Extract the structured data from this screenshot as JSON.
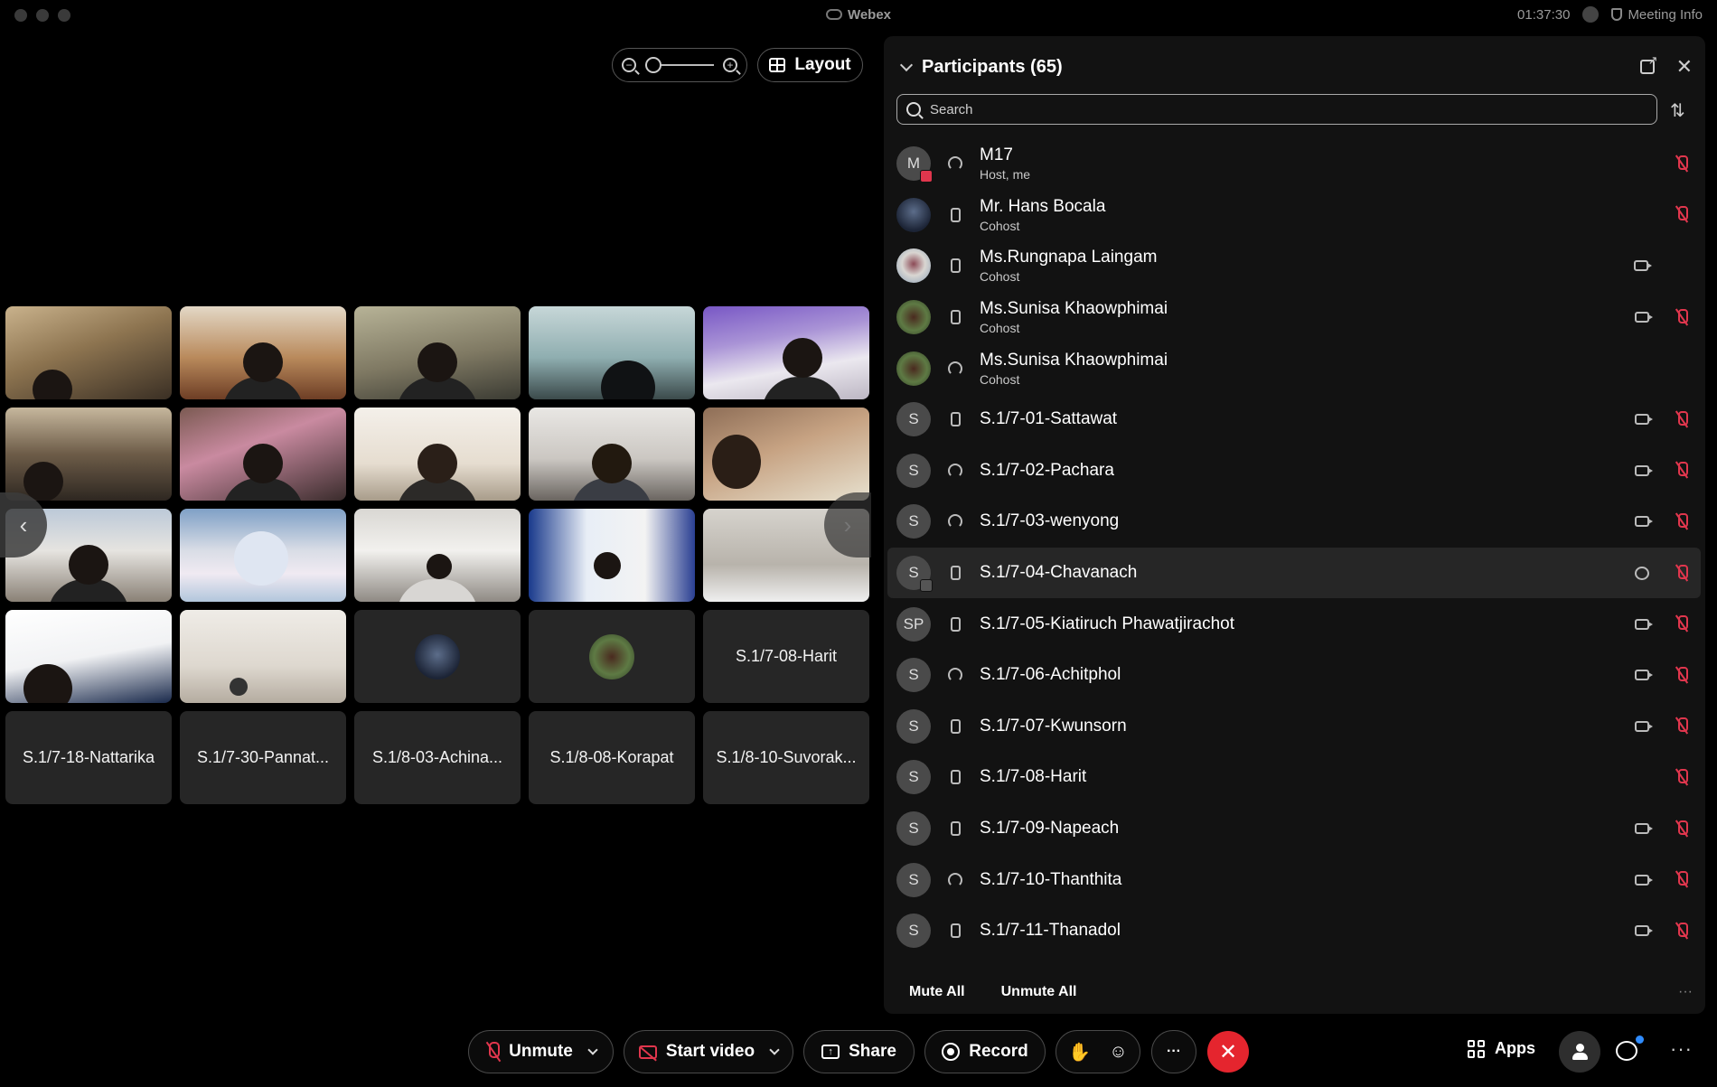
{
  "window": {
    "app_title": "Webex",
    "clock": "01:37:30",
    "meeting_info_label": "Meeting Info"
  },
  "video_controls": {
    "layout_label": "Layout",
    "zoom_level": 0.0
  },
  "video_grid": {
    "name_tiles": [
      "S.1/7-08-Harit",
      "S.1/7-18-Nattarika",
      "S.1/7-30-Pannat...",
      "S.1/8-03-Achina...",
      "S.1/8-08-Korapat",
      "S.1/8-10-Suvorak..."
    ]
  },
  "participants": {
    "title": "Participants (65)",
    "search_placeholder": "Search",
    "items": [
      {
        "initials": "M",
        "name": "M17",
        "role": "Host, me"
      },
      {
        "initials": "",
        "name": "Mr. Hans Bocala",
        "role": "Cohost"
      },
      {
        "initials": "",
        "name": "Ms.Rungnapa Laingam",
        "role": "Cohost"
      },
      {
        "initials": "",
        "name": "Ms.Sunisa Khaowphimai",
        "role": "Cohost"
      },
      {
        "initials": "",
        "name": "Ms.Sunisa Khaowphimai",
        "role": "Cohost"
      },
      {
        "initials": "S",
        "name": "S.1/7-01-Sattawat",
        "role": ""
      },
      {
        "initials": "S",
        "name": "S.1/7-02-Pachara",
        "role": ""
      },
      {
        "initials": "S",
        "name": "S.1/7-03-wenyong",
        "role": ""
      },
      {
        "initials": "S",
        "name": "S.1/7-04-Chavanach",
        "role": ""
      },
      {
        "initials": "SP",
        "name": "S.1/7-05-Kiatiruch Phawatjirachot",
        "role": ""
      },
      {
        "initials": "S",
        "name": "S.1/7-06-Achitphol",
        "role": ""
      },
      {
        "initials": "S",
        "name": "S.1/7-07-Kwunsorn",
        "role": ""
      },
      {
        "initials": "S",
        "name": "S.1/7-08-Harit",
        "role": ""
      },
      {
        "initials": "S",
        "name": "S.1/7-09-Napeach",
        "role": ""
      },
      {
        "initials": "S",
        "name": "S.1/7-10-Thanthita",
        "role": ""
      },
      {
        "initials": "S",
        "name": "S.1/7-11-Thanadol",
        "role": ""
      }
    ],
    "mute_all_label": "Mute All",
    "unmute_all_label": "Unmute All"
  },
  "toolbar": {
    "unmute_label": "Unmute",
    "start_video_label": "Start video",
    "share_label": "Share",
    "record_label": "Record",
    "apps_label": "Apps",
    "end_color": "#e5252e",
    "mute_icon_color": "#e0364d"
  }
}
